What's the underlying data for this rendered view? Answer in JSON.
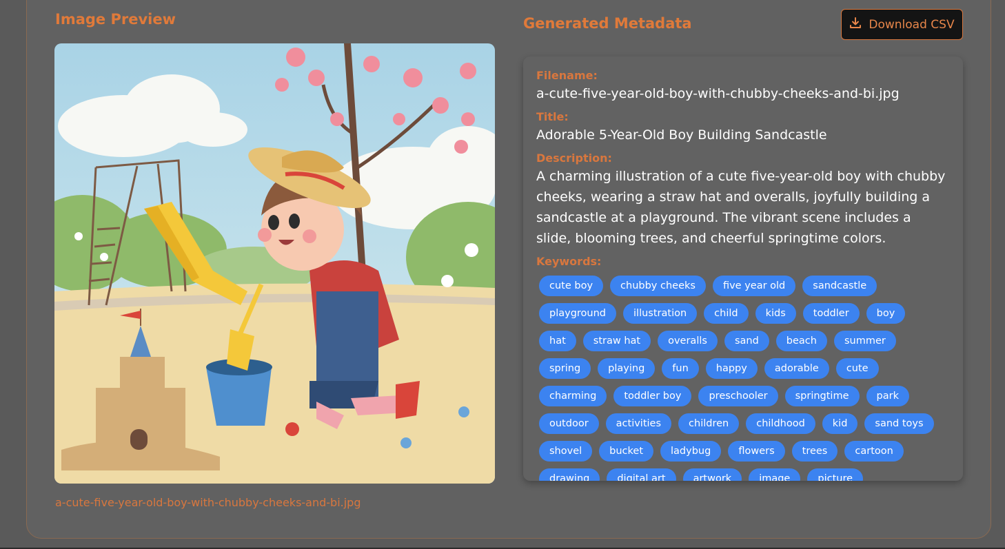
{
  "preview": {
    "heading": "Image Preview",
    "filename_caption": "a-cute-five-year-old-boy-with-chubby-cheeks-and-bi.jpg"
  },
  "metadata": {
    "heading": "Generated Metadata",
    "download_label": "Download CSV",
    "filename_label": "Filename:",
    "filename_value": "a-cute-five-year-old-boy-with-chubby-cheeks-and-bi.jpg",
    "title_label": "Title:",
    "title_value": "Adorable 5-Year-Old Boy Building Sandcastle",
    "description_label": "Description:",
    "description_value": "A charming illustration of a cute five-year-old boy with chubby cheeks, wearing a straw hat and overalls, joyfully building a sandcastle at a playground. The vibrant scene includes a slide, blooming trees, and cheerful springtime colors.",
    "keywords_label": "Keywords:",
    "keywords": [
      "cute boy",
      "chubby cheeks",
      "five year old",
      "sandcastle",
      "playground",
      "illustration",
      "child",
      "kids",
      "toddler",
      "boy",
      "hat",
      "straw hat",
      "overalls",
      "sand",
      "beach",
      "summer",
      "spring",
      "playing",
      "fun",
      "happy",
      "adorable",
      "cute",
      "charming",
      "toddler boy",
      "preschooler",
      "springtime",
      "park",
      "outdoor",
      "activities",
      "children",
      "childhood",
      "kid",
      "sand toys",
      "shovel",
      "bucket",
      "ladybug",
      "flowers",
      "trees",
      "cartoon",
      "drawing",
      "digital art",
      "artwork",
      "image",
      "picture"
    ]
  },
  "colors": {
    "accent": "#e07a3a",
    "tag_bg": "#3c83f0",
    "panel_bg": "#616161"
  },
  "icons": {
    "download": "download-icon"
  }
}
